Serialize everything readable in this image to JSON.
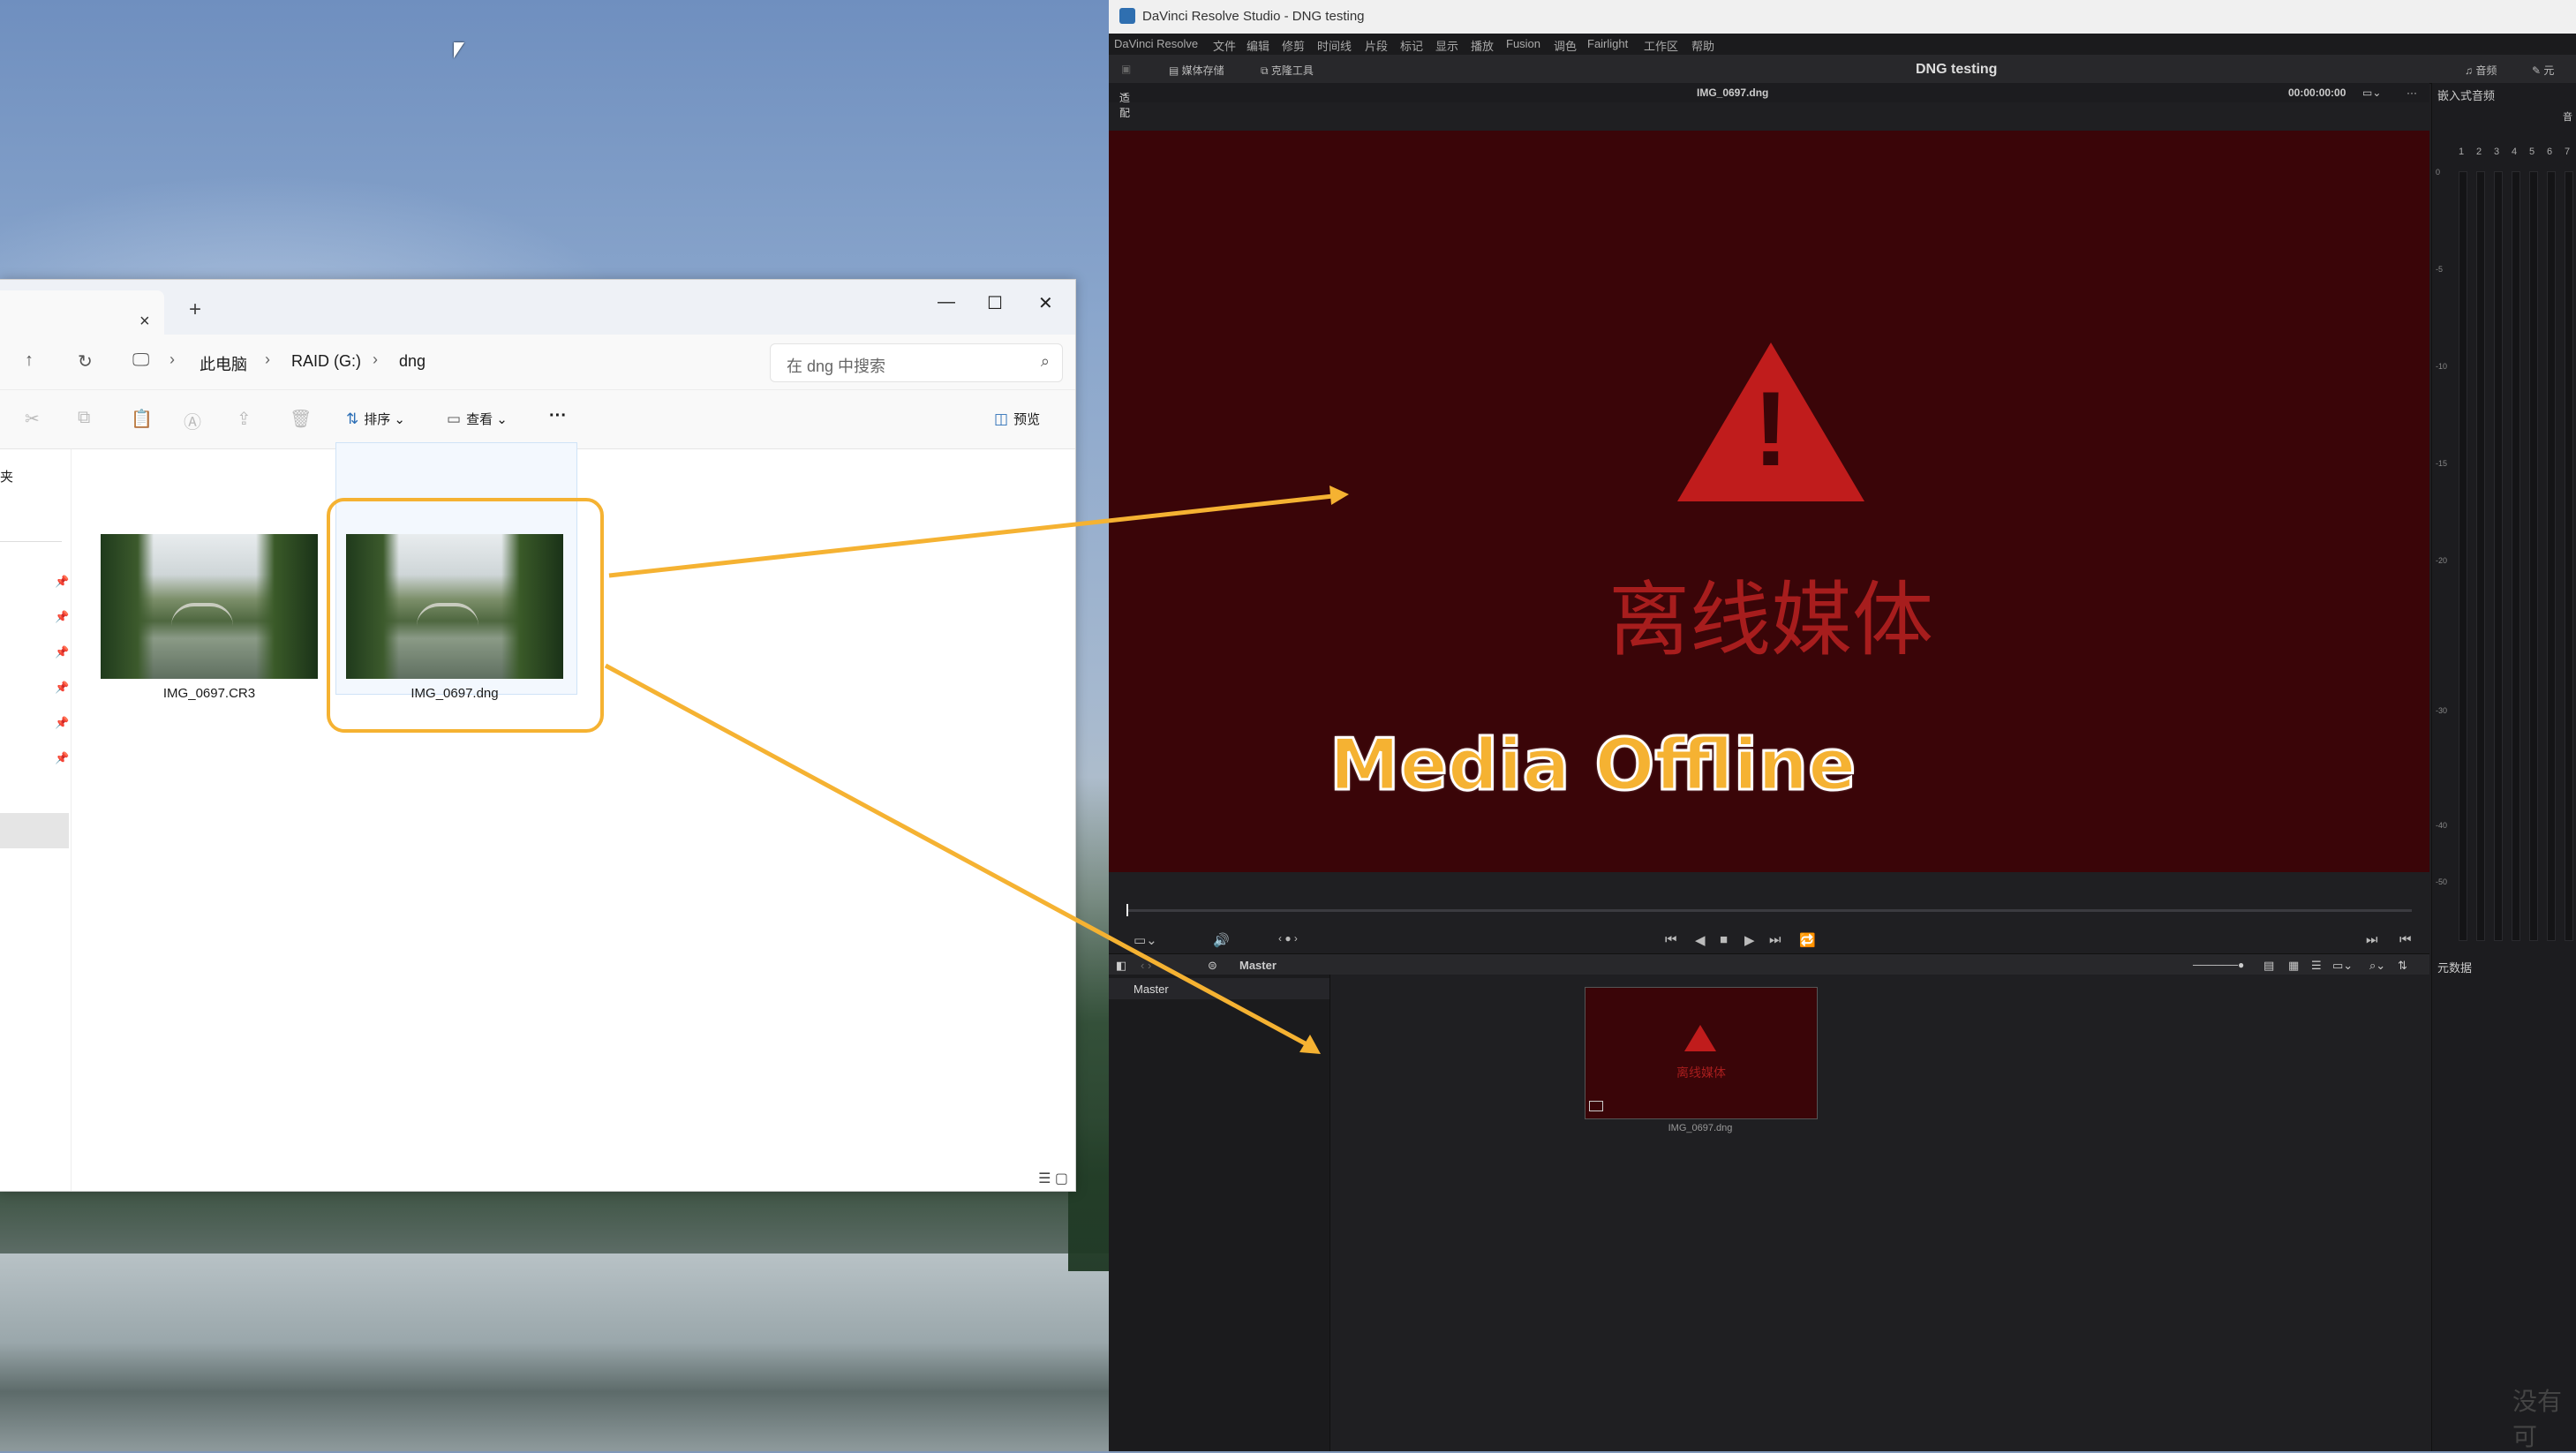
{
  "desktop": {
    "wallpaper": "misty lake with forest"
  },
  "explorer": {
    "tab_close": "×",
    "new_tab": "+",
    "window_buttons": {
      "minimize": "—",
      "maximize": "☐",
      "close": "✕"
    },
    "breadcrumb": [
      "此电脑",
      "RAID (G:)",
      "dng"
    ],
    "search_placeholder": "在 dng 中搜索",
    "toolbar": {
      "sort": "排序",
      "view": "查看",
      "more": "···",
      "preview": "预览"
    },
    "nav_fragment": "夹",
    "files": [
      {
        "name": "IMG_0697.CR3"
      },
      {
        "name": "IMG_0697.dng"
      }
    ]
  },
  "resolve": {
    "title": "DaVinci Resolve Studio - DNG testing",
    "menu": [
      "DaVinci Resolve",
      "文件",
      "编辑",
      "修剪",
      "时间线",
      "片段",
      "标记",
      "显示",
      "播放",
      "Fusion",
      "调色",
      "Fairlight",
      "工作区",
      "帮助"
    ],
    "toolbar": {
      "media_storage": "媒体存储",
      "clone_tool": "克隆工具",
      "project_name": "DNG testing",
      "audio": "音频",
      "right": "元"
    },
    "viewer": {
      "fit": "适配",
      "clip_name": "IMG_0697.dng",
      "timecode": "00:00:00:00",
      "offline_text": "离线媒体"
    },
    "annotation": "Media Offline",
    "bin": {
      "header": "Master",
      "sidebar_item": "Master",
      "clip_label": "离线媒体",
      "clip_name": "IMG_0697.dng"
    },
    "right_panel": {
      "embedded_audio": "嵌入式音频",
      "audio_tab": "音",
      "channels": [
        "1",
        "2",
        "3",
        "4",
        "5",
        "6",
        "7"
      ],
      "scale": [
        "0",
        "-5",
        "-10",
        "-15",
        "-20",
        "-30",
        "-40",
        "-50"
      ],
      "metadata": "元数据"
    },
    "watermark": "没有可"
  },
  "colors": {
    "offline_bg": "#3a0508",
    "warning_red": "#c01c1c",
    "annotation": "#f5b232"
  }
}
